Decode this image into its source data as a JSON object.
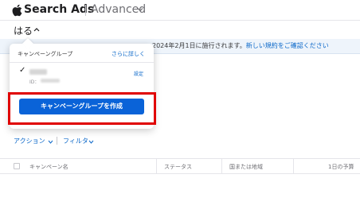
{
  "header": {
    "brand": "Search Ads",
    "product": "Advanced"
  },
  "account": {
    "name": "はる"
  },
  "notice": {
    "text": "2024年2月1日に施行されます。",
    "link": "新しい規約をご確認ください"
  },
  "popover": {
    "heading": "キャンペーングループ",
    "more_link": "さらに詳しく",
    "item": {
      "id_label": "ID：",
      "settings_link": "設定"
    },
    "create_button": "キャンペーングループを作成"
  },
  "toolbar": {
    "actions": "アクション",
    "filter": "フィルタ"
  },
  "table": {
    "columns": [
      "キャンペーン名",
      "ステータス",
      "国または地域",
      "1日の予算"
    ]
  },
  "colors": {
    "accent": "#0a63d8",
    "link": "#0a67c9",
    "highlight": "#e00000"
  },
  "icons": [
    "apple-logo-icon",
    "chevron-down-icon",
    "chevron-up-icon",
    "checkmark-icon"
  ]
}
